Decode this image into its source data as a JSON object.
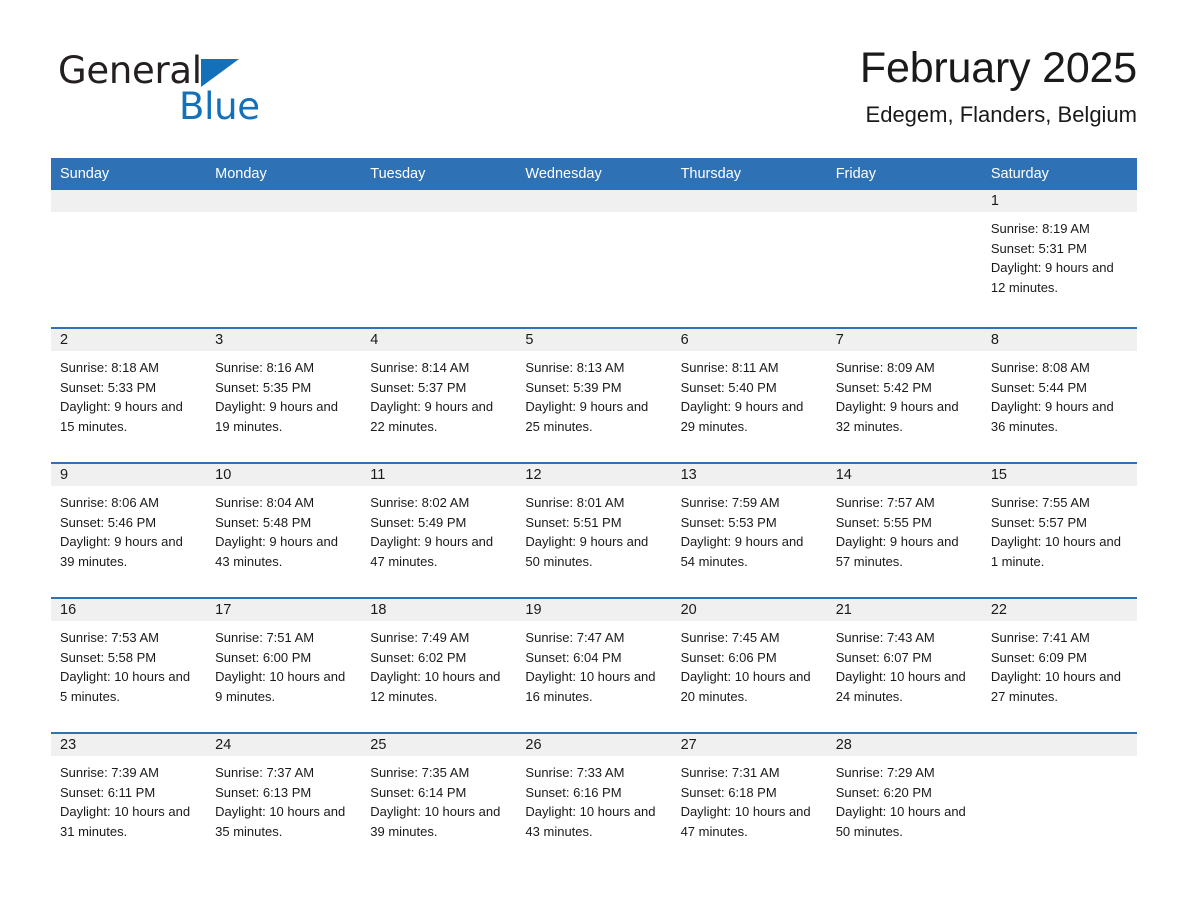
{
  "brand": {
    "name_part1": "General",
    "name_part2": "Blue"
  },
  "header": {
    "title": "February 2025",
    "location": "Edegem, Flanders, Belgium"
  },
  "theme": {
    "header_blue": "#2e72b5",
    "logo_blue": "#1470b8",
    "daynum_band": "#f0f0f0",
    "text": "#1a1a1a"
  },
  "weekday_headers": [
    "Sunday",
    "Monday",
    "Tuesday",
    "Wednesday",
    "Thursday",
    "Friday",
    "Saturday"
  ],
  "labels": {
    "sunrise_prefix": "Sunrise:",
    "sunset_prefix": "Sunset:",
    "daylight_prefix": "Daylight:"
  },
  "weeks": [
    [
      {
        "day": "",
        "empty": true
      },
      {
        "day": "",
        "empty": true
      },
      {
        "day": "",
        "empty": true
      },
      {
        "day": "",
        "empty": true
      },
      {
        "day": "",
        "empty": true
      },
      {
        "day": "",
        "empty": true
      },
      {
        "day": "1",
        "sunrise": "Sunrise: 8:19 AM",
        "sunset": "Sunset: 5:31 PM",
        "daylight": "Daylight: 9 hours and 12 minutes."
      }
    ],
    [
      {
        "day": "2",
        "sunrise": "Sunrise: 8:18 AM",
        "sunset": "Sunset: 5:33 PM",
        "daylight": "Daylight: 9 hours and 15 minutes."
      },
      {
        "day": "3",
        "sunrise": "Sunrise: 8:16 AM",
        "sunset": "Sunset: 5:35 PM",
        "daylight": "Daylight: 9 hours and 19 minutes."
      },
      {
        "day": "4",
        "sunrise": "Sunrise: 8:14 AM",
        "sunset": "Sunset: 5:37 PM",
        "daylight": "Daylight: 9 hours and 22 minutes."
      },
      {
        "day": "5",
        "sunrise": "Sunrise: 8:13 AM",
        "sunset": "Sunset: 5:39 PM",
        "daylight": "Daylight: 9 hours and 25 minutes."
      },
      {
        "day": "6",
        "sunrise": "Sunrise: 8:11 AM",
        "sunset": "Sunset: 5:40 PM",
        "daylight": "Daylight: 9 hours and 29 minutes."
      },
      {
        "day": "7",
        "sunrise": "Sunrise: 8:09 AM",
        "sunset": "Sunset: 5:42 PM",
        "daylight": "Daylight: 9 hours and 32 minutes."
      },
      {
        "day": "8",
        "sunrise": "Sunrise: 8:08 AM",
        "sunset": "Sunset: 5:44 PM",
        "daylight": "Daylight: 9 hours and 36 minutes."
      }
    ],
    [
      {
        "day": "9",
        "sunrise": "Sunrise: 8:06 AM",
        "sunset": "Sunset: 5:46 PM",
        "daylight": "Daylight: 9 hours and 39 minutes."
      },
      {
        "day": "10",
        "sunrise": "Sunrise: 8:04 AM",
        "sunset": "Sunset: 5:48 PM",
        "daylight": "Daylight: 9 hours and 43 minutes."
      },
      {
        "day": "11",
        "sunrise": "Sunrise: 8:02 AM",
        "sunset": "Sunset: 5:49 PM",
        "daylight": "Daylight: 9 hours and 47 minutes."
      },
      {
        "day": "12",
        "sunrise": "Sunrise: 8:01 AM",
        "sunset": "Sunset: 5:51 PM",
        "daylight": "Daylight: 9 hours and 50 minutes."
      },
      {
        "day": "13",
        "sunrise": "Sunrise: 7:59 AM",
        "sunset": "Sunset: 5:53 PM",
        "daylight": "Daylight: 9 hours and 54 minutes."
      },
      {
        "day": "14",
        "sunrise": "Sunrise: 7:57 AM",
        "sunset": "Sunset: 5:55 PM",
        "daylight": "Daylight: 9 hours and 57 minutes."
      },
      {
        "day": "15",
        "sunrise": "Sunrise: 7:55 AM",
        "sunset": "Sunset: 5:57 PM",
        "daylight": "Daylight: 10 hours and 1 minute."
      }
    ],
    [
      {
        "day": "16",
        "sunrise": "Sunrise: 7:53 AM",
        "sunset": "Sunset: 5:58 PM",
        "daylight": "Daylight: 10 hours and 5 minutes."
      },
      {
        "day": "17",
        "sunrise": "Sunrise: 7:51 AM",
        "sunset": "Sunset: 6:00 PM",
        "daylight": "Daylight: 10 hours and 9 minutes."
      },
      {
        "day": "18",
        "sunrise": "Sunrise: 7:49 AM",
        "sunset": "Sunset: 6:02 PM",
        "daylight": "Daylight: 10 hours and 12 minutes."
      },
      {
        "day": "19",
        "sunrise": "Sunrise: 7:47 AM",
        "sunset": "Sunset: 6:04 PM",
        "daylight": "Daylight: 10 hours and 16 minutes."
      },
      {
        "day": "20",
        "sunrise": "Sunrise: 7:45 AM",
        "sunset": "Sunset: 6:06 PM",
        "daylight": "Daylight: 10 hours and 20 minutes."
      },
      {
        "day": "21",
        "sunrise": "Sunrise: 7:43 AM",
        "sunset": "Sunset: 6:07 PM",
        "daylight": "Daylight: 10 hours and 24 minutes."
      },
      {
        "day": "22",
        "sunrise": "Sunrise: 7:41 AM",
        "sunset": "Sunset: 6:09 PM",
        "daylight": "Daylight: 10 hours and 27 minutes."
      }
    ],
    [
      {
        "day": "23",
        "sunrise": "Sunrise: 7:39 AM",
        "sunset": "Sunset: 6:11 PM",
        "daylight": "Daylight: 10 hours and 31 minutes."
      },
      {
        "day": "24",
        "sunrise": "Sunrise: 7:37 AM",
        "sunset": "Sunset: 6:13 PM",
        "daylight": "Daylight: 10 hours and 35 minutes."
      },
      {
        "day": "25",
        "sunrise": "Sunrise: 7:35 AM",
        "sunset": "Sunset: 6:14 PM",
        "daylight": "Daylight: 10 hours and 39 minutes."
      },
      {
        "day": "26",
        "sunrise": "Sunrise: 7:33 AM",
        "sunset": "Sunset: 6:16 PM",
        "daylight": "Daylight: 10 hours and 43 minutes."
      },
      {
        "day": "27",
        "sunrise": "Sunrise: 7:31 AM",
        "sunset": "Sunset: 6:18 PM",
        "daylight": "Daylight: 10 hours and 47 minutes."
      },
      {
        "day": "28",
        "sunrise": "Sunrise: 7:29 AM",
        "sunset": "Sunset: 6:20 PM",
        "daylight": "Daylight: 10 hours and 50 minutes."
      },
      {
        "day": "",
        "empty": true
      }
    ]
  ]
}
